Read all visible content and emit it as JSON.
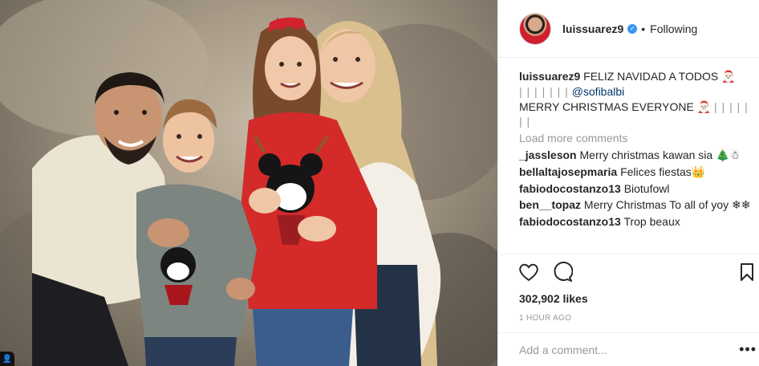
{
  "header": {
    "username": "luissuarez9",
    "separator": "•",
    "follow_status": "Following",
    "verified_glyph": "✓"
  },
  "caption": {
    "username": "luissuarez9",
    "text_1": "FELIZ NAVIDAD A TODOS 🎅🏻",
    "decor_1": "| | | | | | |",
    "mention": "@sofibalbi",
    "text_2": "MERRY CHRISTMAS EVERYONE 🎅🏻",
    "decor_2": "| | | | | | |"
  },
  "load_more": "Load more comments",
  "comments": [
    {
      "user": "_jassleson",
      "text": "Merry christmas kawan sia 🎄☃"
    },
    {
      "user": "bellaltajosepmaria",
      "text": "Felices fiestas👑"
    },
    {
      "user": "fabiodocostanzo13",
      "text": "Biotufowl"
    },
    {
      "user": "ben__topaz",
      "text": "Merry Christmas To all of yoy ❄❄"
    },
    {
      "user": "fabiodocostanzo13",
      "text": "Trop beaux"
    }
  ],
  "likes": "302,902 likes",
  "timestamp": "1 HOUR AGO",
  "add_comment_placeholder": "Add a comment...",
  "more_glyph": "•••",
  "tag_glyph": "👤",
  "icons": {
    "like": "heart-icon",
    "comment": "comment-bubble-icon",
    "save": "bookmark-icon",
    "options": "more-options-icon",
    "tag": "user-tag-icon"
  },
  "colors": {
    "link": "#003569",
    "verified": "#3897f0",
    "muted": "#999999",
    "border": "#efefef"
  }
}
